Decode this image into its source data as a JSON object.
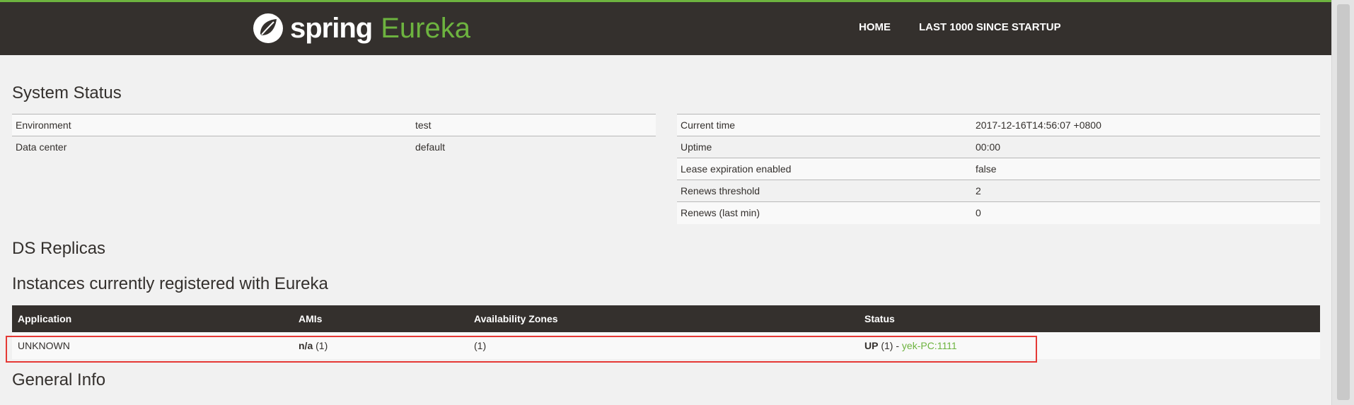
{
  "brand": {
    "spring": "spring",
    "eureka": "Eureka"
  },
  "nav": {
    "home": "HOME",
    "last1000": "LAST 1000 SINCE STARTUP"
  },
  "system_status": {
    "title": "System Status",
    "left": [
      {
        "label": "Environment",
        "value": "test"
      },
      {
        "label": "Data center",
        "value": "default"
      }
    ],
    "right": [
      {
        "label": "Current time",
        "value": "2017-12-16T14:56:07 +0800"
      },
      {
        "label": "Uptime",
        "value": "00:00"
      },
      {
        "label": "Lease expiration enabled",
        "value": "false"
      },
      {
        "label": "Renews threshold",
        "value": "2"
      },
      {
        "label": "Renews (last min)",
        "value": "0"
      }
    ]
  },
  "ds_replicas": {
    "title": "DS Replicas"
  },
  "instances": {
    "title": "Instances currently registered with Eureka",
    "headers": {
      "application": "Application",
      "amis": "AMIs",
      "zones": "Availability Zones",
      "status": "Status"
    },
    "rows": [
      {
        "application": "UNKNOWN",
        "amis_bold": "n/a",
        "amis_count": "(1)",
        "zones": "(1)",
        "status_bold": "UP",
        "status_count": "(1) -",
        "instance_link": "yek-PC:1111"
      }
    ]
  },
  "general_info": {
    "title": "General Info"
  },
  "colors": {
    "accent": "#6db33f",
    "nav_bg": "#34302d",
    "highlight": "#e53935"
  }
}
